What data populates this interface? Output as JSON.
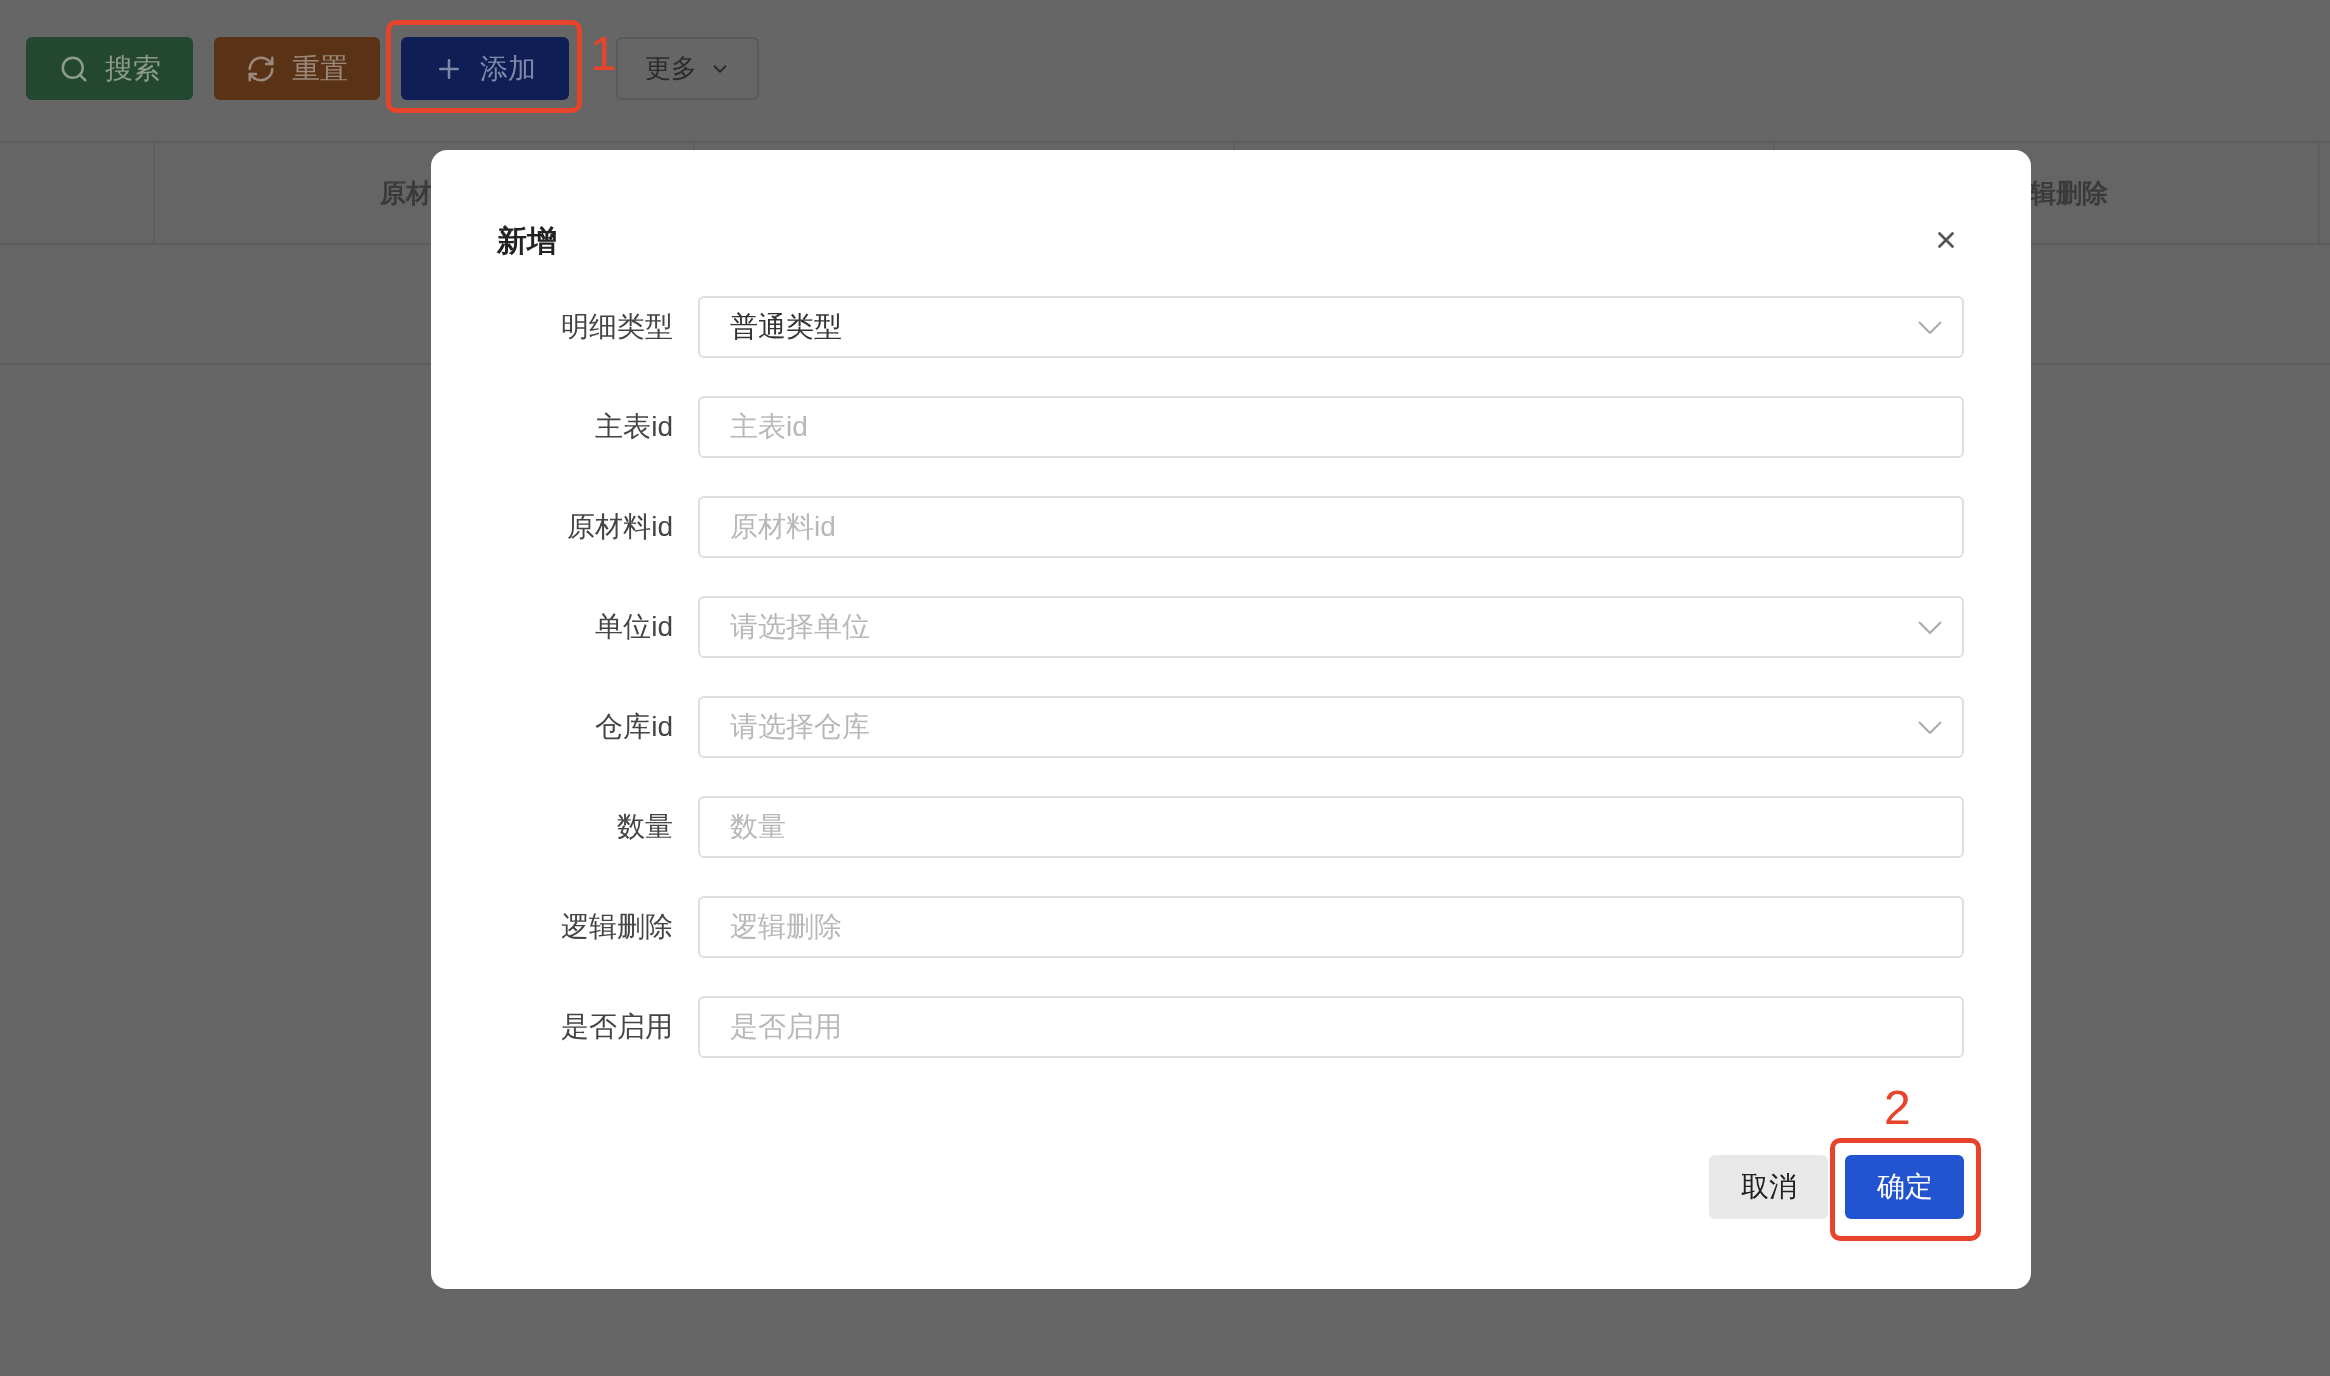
{
  "toolbar": {
    "buttons": [
      {
        "kind": "search",
        "label": "搜索"
      },
      {
        "kind": "reset",
        "label": "重置"
      },
      {
        "kind": "add",
        "label": "添加"
      },
      {
        "kind": "more",
        "label": "更多"
      }
    ]
  },
  "table": {
    "columns": [
      {
        "label": "原材"
      },
      {
        "label": "辑删除"
      }
    ]
  },
  "dialog": {
    "title": "新增",
    "fields": [
      {
        "label": "明细类型",
        "kind": "select",
        "value": "普通类型"
      },
      {
        "label": "主表id",
        "kind": "input",
        "placeholder": "主表id"
      },
      {
        "label": "原材料id",
        "kind": "input",
        "placeholder": "原材料id"
      },
      {
        "label": "单位id",
        "kind": "select",
        "placeholder": "请选择单位"
      },
      {
        "label": "仓库id",
        "kind": "select",
        "placeholder": "请选择仓库"
      },
      {
        "label": "数量",
        "kind": "input",
        "placeholder": "数量"
      },
      {
        "label": "逻辑删除",
        "kind": "input",
        "placeholder": "逻辑删除"
      },
      {
        "label": "是否启用",
        "kind": "input",
        "placeholder": "是否启用"
      }
    ],
    "buttons": [
      {
        "kind": "cancel",
        "label": "取消"
      },
      {
        "kind": "confirm",
        "label": "确定"
      }
    ]
  },
  "annotations": [
    {
      "label": "1"
    },
    {
      "label": "2"
    }
  ]
}
